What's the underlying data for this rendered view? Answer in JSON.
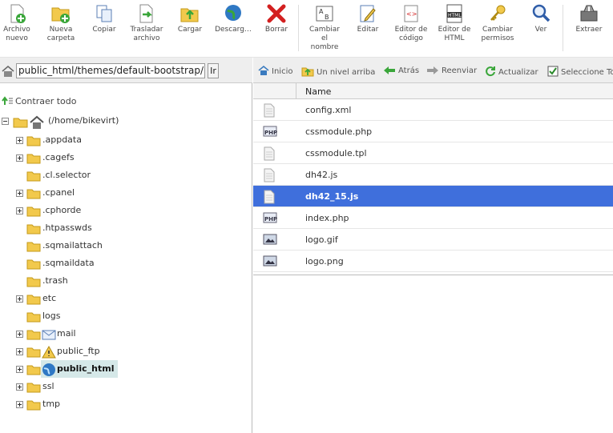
{
  "toolbar": {
    "buttons": [
      {
        "id": "archivo-nuevo",
        "label": "Archivo\nnuevo",
        "icon": "new-file-icon"
      },
      {
        "id": "nueva-carpeta",
        "label": "Nueva\ncarpeta",
        "icon": "new-folder-icon"
      },
      {
        "id": "copiar",
        "label": "Copiar",
        "icon": "copy-icon"
      },
      {
        "id": "trasladar-archivo",
        "label": "Trasladar\narchivo",
        "icon": "move-file-icon"
      },
      {
        "id": "cargar",
        "label": "Cargar",
        "icon": "upload-icon"
      },
      {
        "id": "descargar",
        "label": "Descarg…",
        "icon": "download-globe-icon"
      },
      {
        "id": "borrar",
        "label": "Borrar",
        "icon": "delete-icon"
      },
      {
        "id": "cambiar-nombre",
        "label": "Cambiar\nel\nnombre",
        "icon": "rename-icon"
      },
      {
        "id": "editar",
        "label": "Editar",
        "icon": "edit-icon"
      },
      {
        "id": "editor-codigo",
        "label": "Editor de\ncódigo",
        "icon": "code-editor-icon"
      },
      {
        "id": "editor-html",
        "label": "Editor de\nHTML",
        "icon": "html-editor-icon"
      },
      {
        "id": "cambiar-permisos",
        "label": "Cambiar\npermisos",
        "icon": "permissions-key-icon"
      },
      {
        "id": "ver",
        "label": "Ver",
        "icon": "view-magnifier-icon"
      },
      {
        "id": "extraer",
        "label": "Extraer",
        "icon": "extract-icon"
      }
    ],
    "html_badge": "HTML"
  },
  "pathbar": {
    "path": "public_html/themes/default-bootstrap/m",
    "go_label": "Ir"
  },
  "tree": {
    "collapse_label": "Contraer todo",
    "root_label": "(/home/bikevirt)",
    "items": [
      {
        "label": ".appdata",
        "expandable": true
      },
      {
        "label": ".cagefs",
        "expandable": true
      },
      {
        "label": ".cl.selector",
        "expandable": false
      },
      {
        "label": ".cpanel",
        "expandable": true
      },
      {
        "label": ".cphorde",
        "expandable": true
      },
      {
        "label": ".htpasswds",
        "expandable": false
      },
      {
        "label": ".sqmailattach",
        "expandable": false
      },
      {
        "label": ".sqmaildata",
        "expandable": false
      },
      {
        "label": ".trash",
        "expandable": false
      },
      {
        "label": "etc",
        "expandable": true
      },
      {
        "label": "logs",
        "expandable": false
      },
      {
        "label": "mail",
        "expandable": true,
        "icon": "mail-envelope-icon"
      },
      {
        "label": "public_ftp",
        "expandable": true,
        "icon": "ftp-warning-icon"
      },
      {
        "label": "public_html",
        "expandable": true,
        "icon": "www-globe-icon",
        "selected": true
      },
      {
        "label": "ssl",
        "expandable": true
      },
      {
        "label": "tmp",
        "expandable": true
      }
    ]
  },
  "nav": {
    "inicio": "Inicio",
    "up": "Un nivel arriba",
    "back": "Atrás",
    "forward": "Reenviar",
    "refresh": "Actualizar",
    "select_all": "Seleccione Tod"
  },
  "files": {
    "column_name": "Name",
    "rows": [
      {
        "name": "config.xml",
        "type": "generic"
      },
      {
        "name": "cssmodule.php",
        "type": "php"
      },
      {
        "name": "cssmodule.tpl",
        "type": "generic"
      },
      {
        "name": "dh42.js",
        "type": "generic"
      },
      {
        "name": "dh42_15.js",
        "type": "generic",
        "selected": true
      },
      {
        "name": "index.php",
        "type": "php"
      },
      {
        "name": "logo.gif",
        "type": "image"
      },
      {
        "name": "logo.png",
        "type": "image"
      }
    ],
    "php_badge": "PHP"
  },
  "colors": {
    "selected_row": "#3f6fdc",
    "tree_selected": "#d5e8e8",
    "folder": "#f2c94c"
  }
}
